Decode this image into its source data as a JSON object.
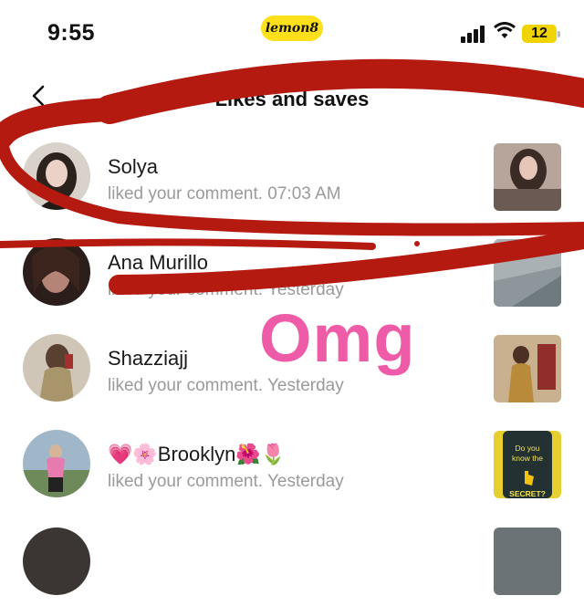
{
  "status_bar": {
    "time": "9:55",
    "brand": "lemon8",
    "battery": "12"
  },
  "header": {
    "title": "Likes and saves",
    "back_icon": "chevron-left-icon"
  },
  "notifications": [
    {
      "name": "Solya",
      "action": "liked your comment. 07:03 AM"
    },
    {
      "name": "Ana Murillo",
      "action": "liked your comment. Yesterday"
    },
    {
      "name": "Shazziajj",
      "action": "liked your comment. Yesterday"
    },
    {
      "name": "💗🌸Brooklyn🌺🌷",
      "action": "liked your comment. Yesterday"
    }
  ],
  "thumb_texts": {
    "brooklyn": "Do you know the SECRET?"
  },
  "annotation": {
    "text": "Omg",
    "ink_color": "#b51a10",
    "text_color": "#ee5ba6"
  }
}
